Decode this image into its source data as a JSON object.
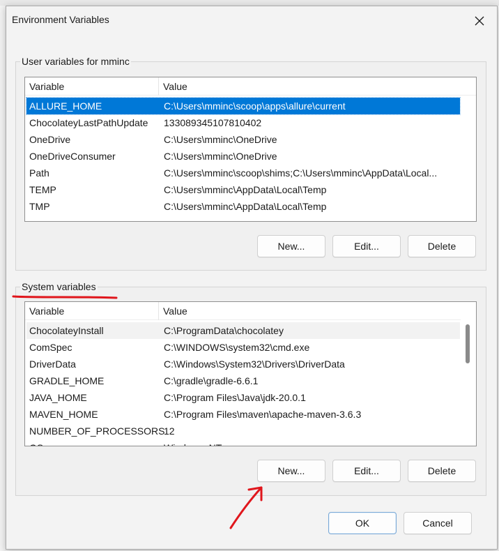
{
  "dialog": {
    "title": "Environment Variables",
    "close_icon": "close-icon"
  },
  "user_vars": {
    "group_label": "User variables for mminc",
    "columns": [
      "Variable",
      "Value"
    ],
    "rows": [
      {
        "variable": "ALLURE_HOME",
        "value": "C:\\Users\\mminc\\scoop\\apps\\allure\\current",
        "selected": true
      },
      {
        "variable": "ChocolateyLastPathUpdate",
        "value": "133089345107810402"
      },
      {
        "variable": "OneDrive",
        "value": "C:\\Users\\mminc\\OneDrive"
      },
      {
        "variable": "OneDriveConsumer",
        "value": "C:\\Users\\mminc\\OneDrive"
      },
      {
        "variable": "Path",
        "value": "C:\\Users\\mminc\\scoop\\shims;C:\\Users\\mminc\\AppData\\Local..."
      },
      {
        "variable": "TEMP",
        "value": "C:\\Users\\mminc\\AppData\\Local\\Temp"
      },
      {
        "variable": "TMP",
        "value": "C:\\Users\\mminc\\AppData\\Local\\Temp"
      }
    ],
    "buttons": {
      "new": "New...",
      "edit": "Edit...",
      "delete": "Delete"
    }
  },
  "system_vars": {
    "group_label": "System variables",
    "columns": [
      "Variable",
      "Value"
    ],
    "rows": [
      {
        "variable": "ChocolateyInstall",
        "value": "C:\\ProgramData\\chocolatey"
      },
      {
        "variable": "ComSpec",
        "value": "C:\\WINDOWS\\system32\\cmd.exe"
      },
      {
        "variable": "DriverData",
        "value": "C:\\Windows\\System32\\Drivers\\DriverData"
      },
      {
        "variable": "GRADLE_HOME",
        "value": "C:\\gradle\\gradle-6.6.1"
      },
      {
        "variable": "JAVA_HOME",
        "value": "C:\\Program Files\\Java\\jdk-20.0.1"
      },
      {
        "variable": "MAVEN_HOME",
        "value": "C:\\Program Files\\maven\\apache-maven-3.6.3"
      },
      {
        "variable": "NUMBER_OF_PROCESSORS",
        "value": "12"
      },
      {
        "variable": "OS",
        "value": "Windows_NT"
      }
    ],
    "buttons": {
      "new": "New...",
      "edit": "Edit...",
      "delete": "Delete"
    }
  },
  "footer": {
    "ok": "OK",
    "cancel": "Cancel"
  },
  "colors": {
    "selection": "#0078d7",
    "annotation": "#e0161c"
  }
}
